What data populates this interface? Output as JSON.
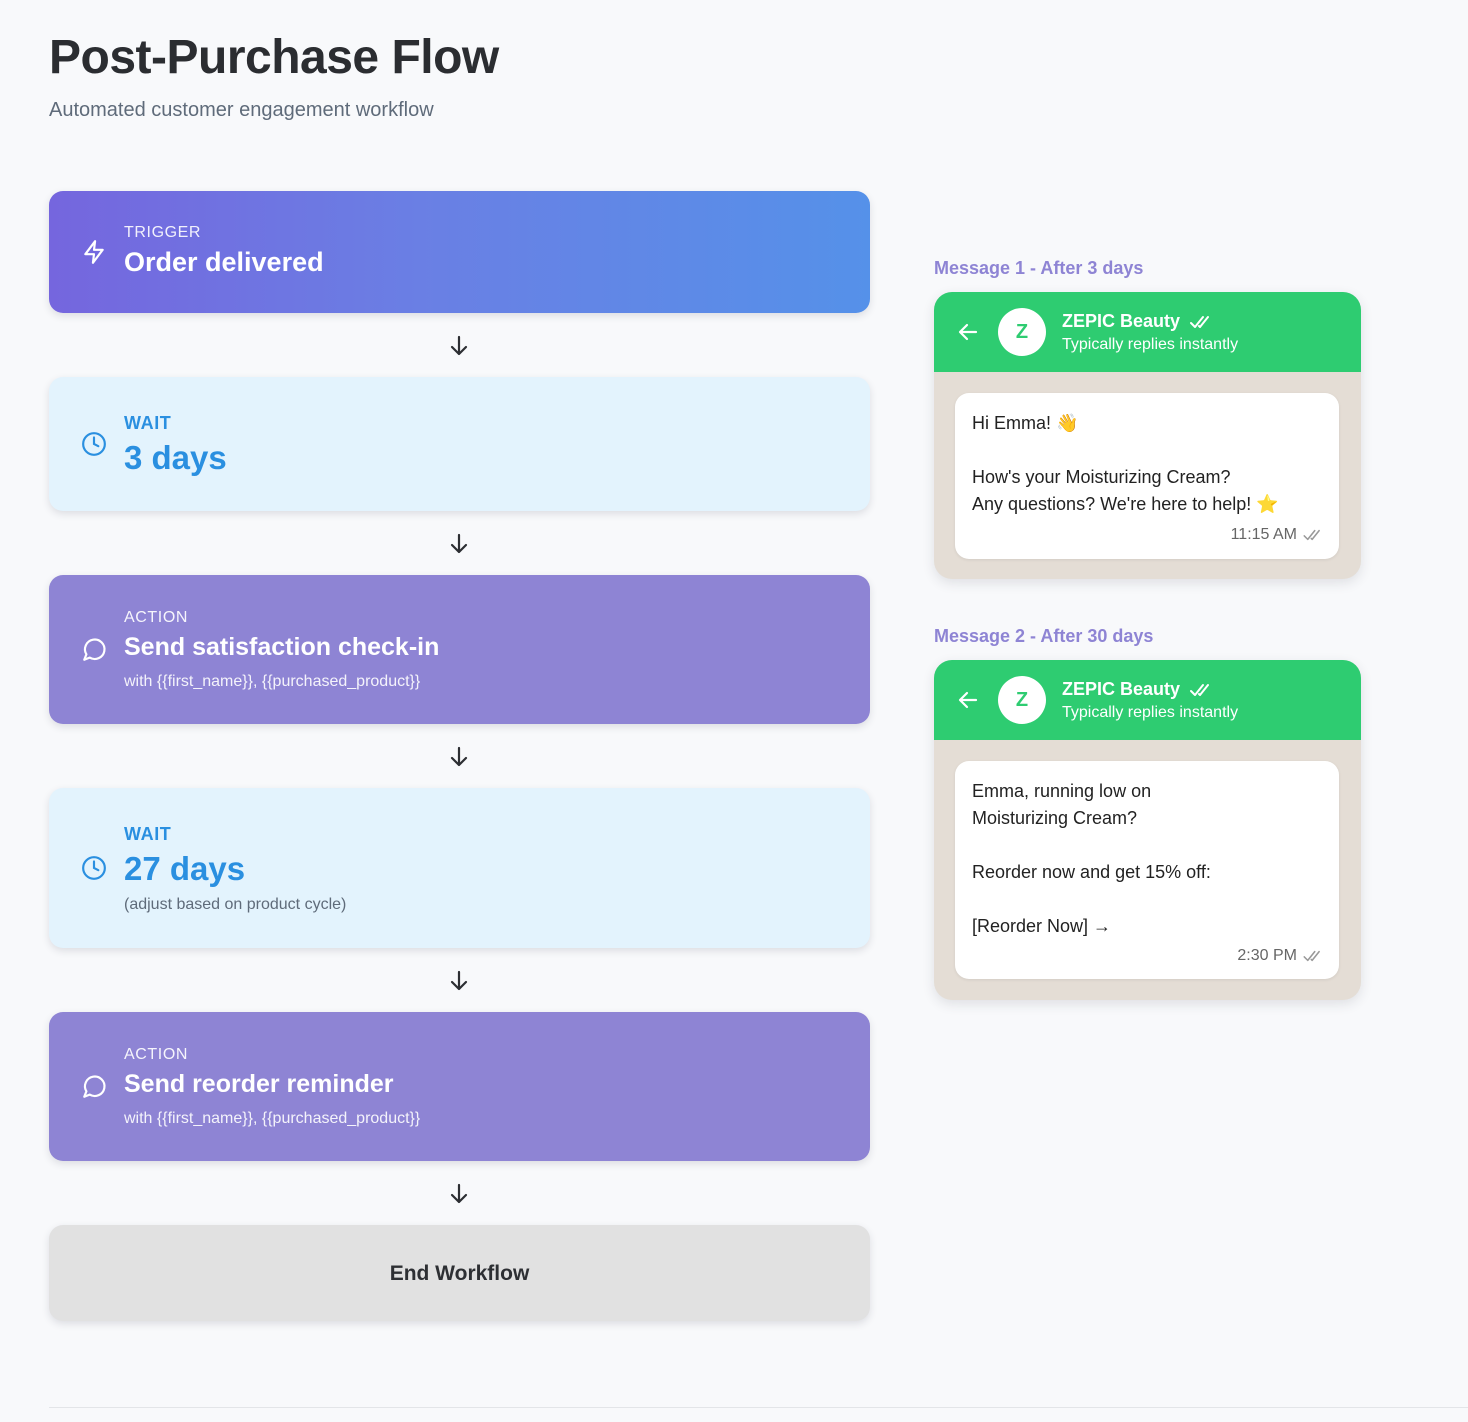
{
  "header": {
    "title": "Post-Purchase Flow",
    "subtitle": "Automated customer engagement workflow"
  },
  "flow": {
    "trigger": {
      "kicker": "TRIGGER",
      "title": "Order delivered",
      "icon": "lightning-icon"
    },
    "wait1": {
      "kicker": "WAIT",
      "title": "3 days",
      "icon": "clock-icon"
    },
    "action1": {
      "kicker": "ACTION",
      "title": "Send satisfaction check-in",
      "sub": "with {{first_name}}, {{purchased_product}}",
      "icon": "chat-bubble-icon"
    },
    "wait2": {
      "kicker": "WAIT",
      "title": "27 days",
      "sub": "(adjust based on product cycle)",
      "icon": "clock-icon"
    },
    "action2": {
      "kicker": "ACTION",
      "title": "Send reorder reminder",
      "sub": "with {{first_name}}, {{purchased_product}}",
      "icon": "chat-bubble-icon"
    },
    "end": {
      "label": "End Workflow"
    }
  },
  "messages": [
    {
      "label": "Message 1 - After 3 days",
      "sender": "ZEPIC Beauty",
      "avatar": "Z",
      "status": "Typically replies instantly",
      "body": "Hi Emma! 👋\n\nHow's your Moisturizing Cream?\nAny questions? We're here to help! ⭐",
      "time": "11:15 AM"
    },
    {
      "label": "Message 2 - After 30 days",
      "sender": "ZEPIC Beauty",
      "avatar": "Z",
      "status": "Typically replies instantly",
      "body": "Emma, running low on\nMoisturizing Cream?\n\nReorder now and get 15% off:\n\n[Reorder Now] →",
      "time": "2:30 PM"
    }
  ],
  "colors": {
    "trigger_start": "#7566de",
    "trigger_end": "#5591e9",
    "wait_bg": "#e3f3fd",
    "wait_text": "#2a8fe0",
    "action_bg": "#8e84d4",
    "end_bg": "#e1e1e1",
    "whatsapp_green": "#2ecc71",
    "chat_bg": "#e4ddd5"
  }
}
